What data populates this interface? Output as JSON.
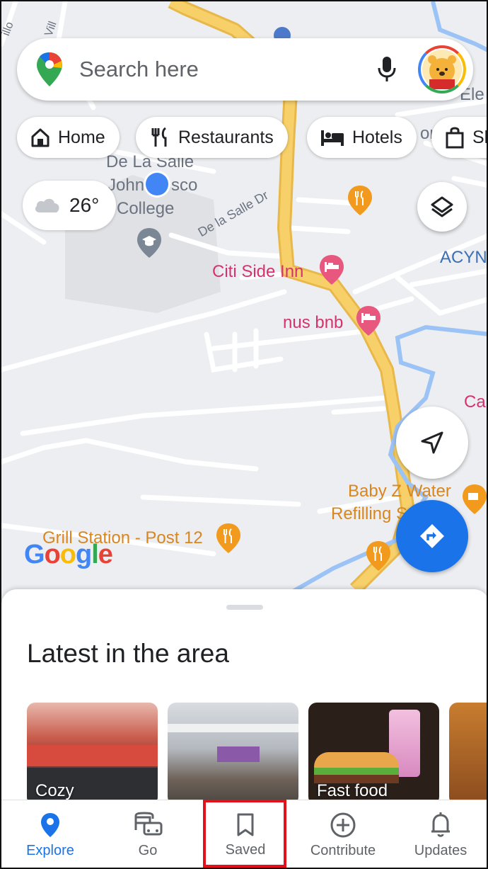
{
  "search": {
    "placeholder": "Search here"
  },
  "chips": [
    {
      "label": "Home",
      "icon": "home-icon"
    },
    {
      "label": "Restaurants",
      "icon": "restaurant-icon"
    },
    {
      "label": "Hotels",
      "icon": "hotel-icon"
    },
    {
      "label": "Sh",
      "icon": "shopping-bag-icon"
    }
  ],
  "weather": {
    "temp": "26°",
    "icon": "cloud-icon"
  },
  "map_labels": {
    "college_line1": "De La Salle",
    "college_line2a": "John",
    "college_line2b": "sco",
    "college_line3": "College",
    "street": "De la Salle Dr",
    "citi_side_inn": "Citi Side Inn",
    "nus_bnb": "nus bnb",
    "acyn": "ACYN",
    "ca": "Ca",
    "ele": "Ele",
    "or": "or",
    "baby_z_1": "Baby Z Water",
    "baby_z_2": "Refilling S",
    "grill_station": "Grill Station - Post 12",
    "villa": "Vill",
    "pillo": "illo"
  },
  "google_logo": "Google",
  "sheet": {
    "title": "Latest in the area",
    "cards": [
      {
        "label": "Cozy"
      },
      {
        "label": ""
      },
      {
        "label": "Fast food"
      },
      {
        "label": ""
      }
    ]
  },
  "nav": [
    {
      "label": "Explore",
      "icon": "explore-pin-icon",
      "active": true
    },
    {
      "label": "Go",
      "icon": "commute-icon",
      "active": false
    },
    {
      "label": "Saved",
      "icon": "bookmark-icon",
      "active": false
    },
    {
      "label": "Contribute",
      "icon": "add-circle-icon",
      "active": false
    },
    {
      "label": "Updates",
      "icon": "bell-icon",
      "active": false
    }
  ],
  "colors": {
    "accent": "#1a73e8",
    "highlight": "#e3111b",
    "road_major": "#f6cf65",
    "water": "#9cc3f5"
  }
}
